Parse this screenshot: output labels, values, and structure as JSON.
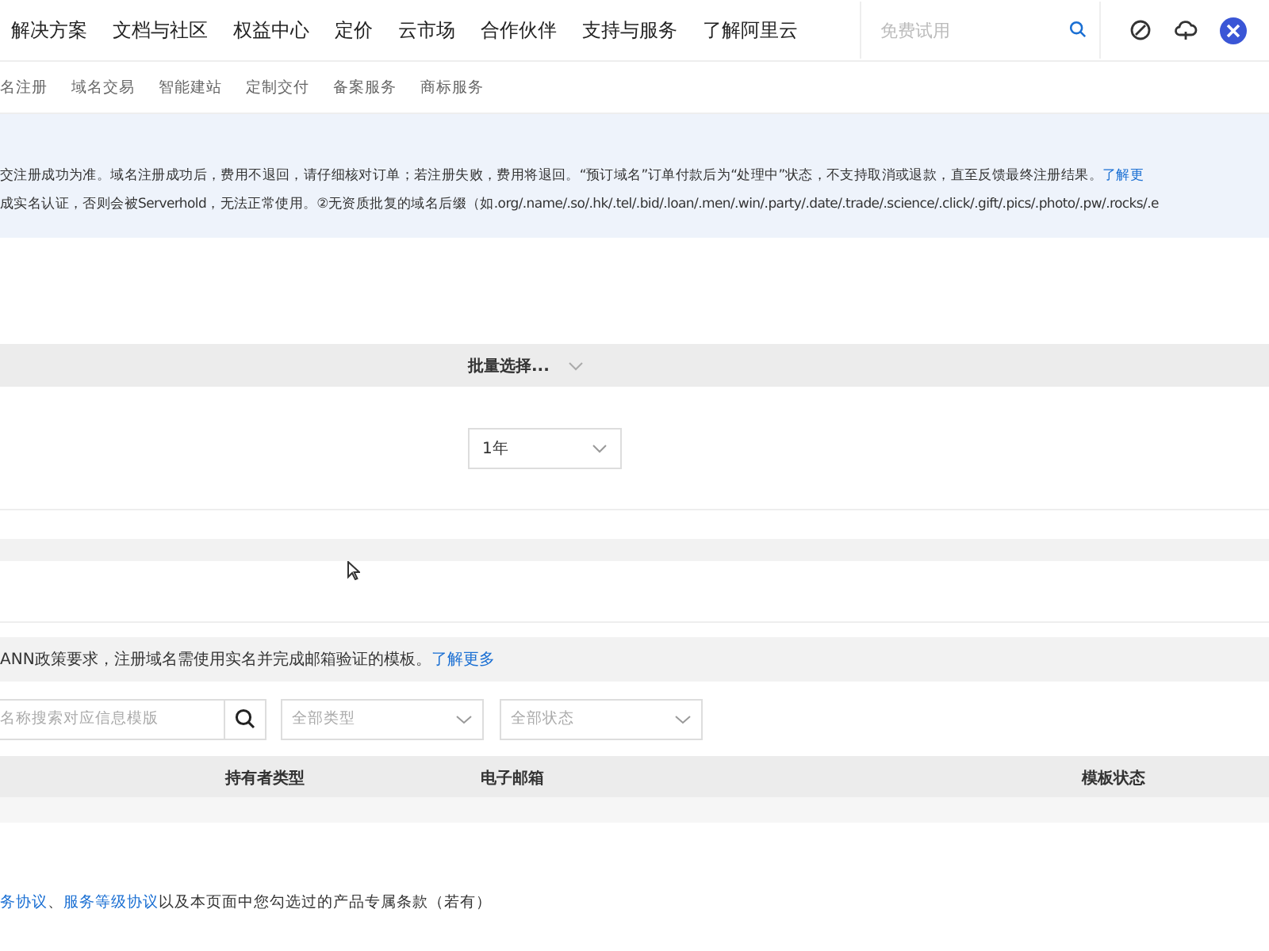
{
  "top_nav": {
    "items": [
      "解决方案",
      "文档与社区",
      "权益中心",
      "定价",
      "云市场",
      "合作伙伴",
      "支持与服务",
      "了解阿里云"
    ],
    "search": {
      "placeholder": "免费试用"
    }
  },
  "sub_nav": {
    "items": [
      "名注册",
      "域名交易",
      "智能建站",
      "定制交付",
      "备案服务",
      "商标服务"
    ]
  },
  "notice": {
    "lines": [
      "交注册成功为准。域名注册成功后，费用不退回，请仔细核对订单；若注册失败，费用将退回。“预订域名”订单付款后为“处理中”状态，不支持取消或退款，直至反馈最终注册结果。",
      "成实名认证，否则会被Serverhold，无法正常使用。②无资质批复的域名后缀（如.org/.name/.so/.hk/.tel/.bid/.loan/.men/.win/.party/.date/.trade/.science/.click/.gift/.pics/.photo/.pw/.rocks/.e"
    ],
    "link": "了解更"
  },
  "batch_select": {
    "label": "批量选择..."
  },
  "period_select": {
    "value": "1年"
  },
  "icann": {
    "text": "ANN政策要求，注册域名需使用实名并完成邮箱验证的模板。",
    "link": "了解更多"
  },
  "filters": {
    "search_placeholder": "名称搜索对应信息模版",
    "type_select": "全部类型",
    "status_select": "全部状态"
  },
  "table": {
    "columns": [
      "持有者类型",
      "电子邮箱",
      "模板状态"
    ]
  },
  "footer": {
    "links": [
      "务协议",
      "服务等级协议"
    ],
    "separator": "、",
    "text": "以及本页面中您勾选过的产品专属条款（若有）"
  }
}
